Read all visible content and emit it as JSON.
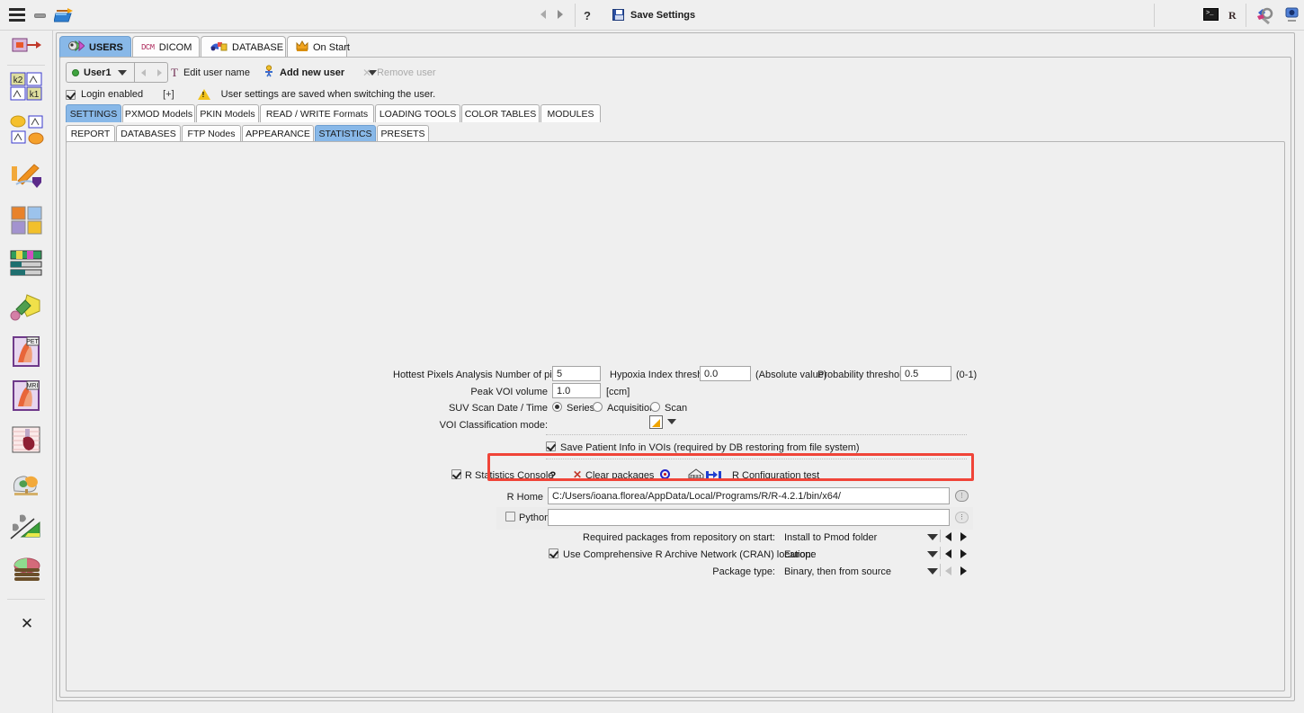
{
  "app": {
    "topbar": {
      "menu_icon": "hamburger-menu-icon",
      "minimize_icon": "minimize-icon",
      "open_icon": "open-folder-icon",
      "back_label": "back-arrow-icon",
      "forward_label": "forward-arrow-icon",
      "help_label": "?",
      "save_label": "Save Settings",
      "terminal_glyph": ">_",
      "r_glyph": "R",
      "tools_icon": "tools-icon",
      "capture_icon": "capture-icon"
    }
  },
  "rail": {
    "items": [
      {
        "name": "kinetic-modeling-tool",
        "label": ""
      },
      {
        "name": "k2-k1-model-tool",
        "label": ""
      },
      {
        "name": "compartment-model-tool",
        "label": ""
      },
      {
        "name": "curve-fitting-tool",
        "label": ""
      },
      {
        "name": "fusion-tool",
        "label": ""
      },
      {
        "name": "color-tables-tool",
        "label": ""
      },
      {
        "name": "segmentation-tool",
        "label": ""
      },
      {
        "name": "pet-viewer-tool",
        "label": ""
      },
      {
        "name": "mri-viewer-tool",
        "label": ""
      },
      {
        "name": "cardiac-tool",
        "label": ""
      },
      {
        "name": "brain-tool",
        "label": ""
      },
      {
        "name": "analysis-tool",
        "label": ""
      },
      {
        "name": "stack-tool",
        "label": ""
      }
    ],
    "close_label": "✕"
  },
  "tabs_level1": [
    {
      "label": "USERS",
      "icon": "users-icon",
      "selected": true
    },
    {
      "label": "DICOM",
      "icon": "dcm-icon",
      "selected": false
    },
    {
      "label": "DATABASE",
      "icon": "database-icon",
      "selected": false
    },
    {
      "label": "On Start",
      "icon": "onstart-icon",
      "selected": false
    }
  ],
  "user_toolbar": {
    "current_user": "User1",
    "edit_user_name": "Edit user name",
    "add_new_user": "Add new user",
    "remove_user": "Remove user",
    "edit_glyph": "T",
    "remove_glyph": "✕"
  },
  "login_row": {
    "login_enabled_label": "Login enabled",
    "login_enabled_checked": true,
    "expand_label": "[+]",
    "warning_text": "User settings are saved when switching the user."
  },
  "tabs_level2": [
    {
      "label": "SETTINGS",
      "selected": true
    },
    {
      "label": "PXMOD Models",
      "selected": false
    },
    {
      "label": "PKIN Models",
      "selected": false
    },
    {
      "label": "READ / WRITE Formats",
      "selected": false
    },
    {
      "label": "LOADING TOOLS",
      "selected": false
    },
    {
      "label": "COLOR TABLES",
      "selected": false
    },
    {
      "label": "MODULES",
      "selected": false
    }
  ],
  "tabs_level3": [
    {
      "label": "REPORT",
      "selected": false
    },
    {
      "label": "DATABASES",
      "selected": false
    },
    {
      "label": "FTP Nodes",
      "selected": false
    },
    {
      "label": "APPEARANCE",
      "selected": false
    },
    {
      "label": "STATISTICS",
      "selected": true
    },
    {
      "label": "PRESETS",
      "selected": false
    }
  ],
  "statistics": {
    "hottest_pixels_label": "Hottest Pixels Analysis Number of pixels",
    "hottest_pixels_value": "5",
    "hypoxia_label": "Hypoxia Index threshold",
    "hypoxia_value": "0.0",
    "hypoxia_suffix": "(Absolute value)",
    "probability_label": "Probability threshold",
    "probability_value": "0.5",
    "probability_suffix": "(0-1)",
    "peak_voi_label": "Peak VOI volume",
    "peak_voi_value": "1.0",
    "peak_voi_unit": "[ccm]",
    "suv_label": "SUV Scan Date / Time",
    "suv_options": [
      {
        "label": "Series",
        "selected": true
      },
      {
        "label": "Acquisition",
        "selected": false
      },
      {
        "label": "Scan",
        "selected": false
      }
    ],
    "voi_classification_label": "VOI Classification mode:",
    "save_patient_info_label": "Save Patient Info in VOIs (required by DB restoring from file system)",
    "save_patient_info_checked": true
  },
  "r_section": {
    "console_label": "R Statistics Console",
    "console_checked": true,
    "help_label": "?",
    "clear_packages_label": "Clear packages",
    "config_test_label": "R Configuration test",
    "r_home_label": "R Home",
    "r_home_value": "C:/Users/ioana.florea/AppData/Local/Programs/R/R-4.2.1/bin/x64/",
    "python_label": "Python",
    "python_checked": false,
    "python_value": "",
    "python_placeholder": "",
    "required_packages_label": "Required packages from repository on start:",
    "required_packages_value": "Install to Pmod folder",
    "cran_label": "Use Comprehensive R Archive Network (CRAN) location:",
    "cran_checked": true,
    "cran_value": "Europe",
    "package_type_label": "Package type:",
    "package_type_value": "Binary, then from source"
  },
  "colors": {
    "tab_selected": "#88b8e8",
    "highlight_box": "#f04438",
    "window_bg": "#efefef",
    "field_bg": "#ffffff"
  }
}
